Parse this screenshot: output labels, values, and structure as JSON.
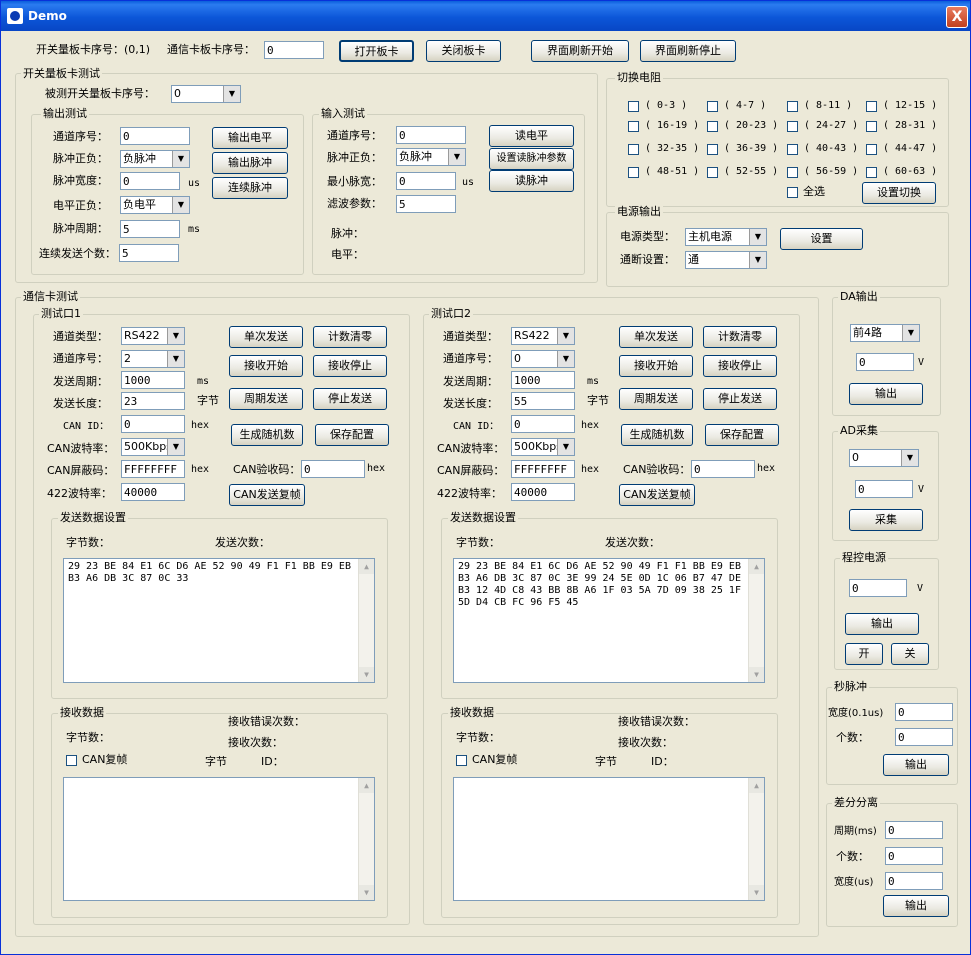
{
  "window": {
    "title": "Demo",
    "close": "X"
  },
  "top": {
    "switch_card_label": "开关量板卡序号：(0,1)",
    "comm_card_label": "通信卡板卡序号：",
    "comm_card_value": "0",
    "btn_open": "打开板卡",
    "btn_close": "关闭板卡",
    "btn_refresh_start": "界面刷新开始",
    "btn_refresh_stop": "界面刷新停止"
  },
  "switch_test": {
    "title": "开关量板卡测试",
    "dut_label": "被测开关量板卡序号：",
    "dut_value": "0",
    "output": {
      "title": "输出测试",
      "channel_label": "通道序号：",
      "channel_value": "0",
      "polarity_label": "脉冲正负：",
      "polarity_value": "负脉冲",
      "width_label": "脉冲宽度：",
      "width_value": "0",
      "width_unit": "us",
      "level_polarity_label": "电平正负：",
      "level_polarity_value": "负电平",
      "period_label": "脉冲周期：",
      "period_value": "5",
      "period_unit": "ms",
      "count_label": "连续发送个数：",
      "count_value": "5",
      "btn_level": "输出电平",
      "btn_pulse": "输出脉冲",
      "btn_cont": "连续脉冲"
    },
    "input": {
      "title": "输入测试",
      "channel_label": "通道序号：",
      "channel_value": "0",
      "polarity_label": "脉冲正负：",
      "polarity_value": "负脉冲",
      "minwidth_label": "最小脉宽：",
      "minwidth_value": "0",
      "minwidth_unit": "us",
      "filter_label": "滤波参数：",
      "filter_value": "5",
      "pulse_label": "脉冲：",
      "level_label": "电平：",
      "btn_read_level": "读电平",
      "btn_set_read": "设置读脉冲参数",
      "btn_read_pulse": "读脉冲"
    }
  },
  "resistor": {
    "title": "切换电阻",
    "items": [
      "( 0-3 )",
      "( 4-7 )",
      "( 8-11 )",
      "( 12-15 )",
      "( 16-19 )",
      "( 20-23 )",
      "( 24-27 )",
      "( 28-31 )",
      "( 32-35 )",
      "( 36-39 )",
      "( 40-43 )",
      "( 44-47 )",
      "( 48-51 )",
      "( 52-55 )",
      "( 56-59 )",
      "( 60-63 )"
    ],
    "select_all": "全选",
    "btn_set": "设置切换"
  },
  "power": {
    "title": "电源输出",
    "type_label": "电源类型：",
    "type_value": "主机电源",
    "onoff_label": "通断设置：",
    "onoff_value": "通",
    "btn_set": "设置"
  },
  "comm": {
    "title": "通信卡测试",
    "ports": [
      {
        "title": "测试口1",
        "type_label": "通道类型：",
        "type_value": "RS422",
        "channel_label": "通道序号：",
        "channel_value": "2",
        "period_label": "发送周期：",
        "period_value": "1000",
        "period_unit": "ms",
        "length_label": "发送长度：",
        "length_value": "23",
        "length_unit": "字节",
        "canid_label": "CAN ID：",
        "canid_value": "0",
        "canid_unit": "hex",
        "baud_label": "CAN波特率：",
        "baud_value": "500Kbps",
        "mask_label": "CAN屏蔽码：",
        "mask_value": "FFFFFFFF",
        "mask_unit": "hex",
        "baud422_label": "422波特率：",
        "baud422_value": "40000",
        "check_label": "CAN验收码：",
        "check_value": "0",
        "check_unit": "hex",
        "btn_single": "单次发送",
        "btn_clear": "计数清零",
        "btn_recv_start": "接收开始",
        "btn_recv_stop": "接收停止",
        "btn_cycle": "周期发送",
        "btn_stop_send": "停止发送",
        "btn_random": "生成随机数",
        "btn_save": "保存配置",
        "btn_can_reset": "CAN发送复帧",
        "send": {
          "title": "发送数据设置",
          "bytes_label": "字节数：",
          "count_label": "发送次数：",
          "data": "29 23 BE 84 E1 6C D6 AE 52 90 49 F1 F1 BB E9 EB\nB3 A6 DB 3C 87 0C 33"
        },
        "recv": {
          "title": "接收数据",
          "bytes_label": "字节数：",
          "err_label": "接收错误次数：",
          "count_label": "接收次数：",
          "can_reset": "CAN复帧",
          "byte_label": "字节",
          "id_label": "ID："
        }
      },
      {
        "title": "测试口2",
        "type_label": "通道类型：",
        "type_value": "RS422",
        "channel_label": "通道序号：",
        "channel_value": "0",
        "period_label": "发送周期：",
        "period_value": "1000",
        "period_unit": "ms",
        "length_label": "发送长度：",
        "length_value": "55",
        "length_unit": "字节",
        "canid_label": "CAN ID：",
        "canid_value": "0",
        "canid_unit": "hex",
        "baud_label": "CAN波特率：",
        "baud_value": "500Kbps",
        "mask_label": "CAN屏蔽码：",
        "mask_value": "FFFFFFFF",
        "mask_unit": "hex",
        "baud422_label": "422波特率：",
        "baud422_value": "40000",
        "check_label": "CAN验收码：",
        "check_value": "0",
        "check_unit": "hex",
        "btn_single": "单次发送",
        "btn_clear": "计数清零",
        "btn_recv_start": "接收开始",
        "btn_recv_stop": "接收停止",
        "btn_cycle": "周期发送",
        "btn_stop_send": "停止发送",
        "btn_random": "生成随机数",
        "btn_save": "保存配置",
        "btn_can_reset": "CAN发送复帧",
        "send": {
          "title": "发送数据设置",
          "bytes_label": "字节数：",
          "count_label": "发送次数：",
          "data": "29 23 BE 84 E1 6C D6 AE 52 90 49 F1 F1 BB E9 EB\nB3 A6 DB 3C 87 0C 3E 99 24 5E 0D 1C 06 B7 47 DE\nB3 12 4D C8 43 BB 8B A6 1F 03 5A 7D 09 38 25 1F\n5D D4 CB FC 96 F5 45"
        },
        "recv": {
          "title": "接收数据",
          "bytes_label": "字节数：",
          "err_label": "接收错误次数：",
          "count_label": "接收次数：",
          "can_reset": "CAN复帧",
          "byte_label": "字节",
          "id_label": "ID："
        }
      }
    ]
  },
  "da": {
    "title": "DA输出",
    "channel_value": "前4路",
    "value": "0",
    "unit": "V",
    "btn": "输出"
  },
  "ad": {
    "title": "AD采集",
    "channel_value": "0",
    "value": "0",
    "unit": "V",
    "btn": "采集"
  },
  "prog_power": {
    "title": "程控电源",
    "value": "0",
    "unit": "V",
    "btn_out": "输出",
    "btn_on": "开",
    "btn_off": "关"
  },
  "sec_pulse": {
    "title": "秒脉冲",
    "width_label": "宽度(0.1us)",
    "width_value": "0",
    "count_label": "个数：",
    "count_value": "0",
    "btn": "输出"
  },
  "diff": {
    "title": "差分分离",
    "period_label": "周期(ms)",
    "period_value": "0",
    "count_label": "个数：",
    "count_value": "0",
    "width_label": "宽度(us)",
    "width_value": "0",
    "btn": "输出"
  }
}
